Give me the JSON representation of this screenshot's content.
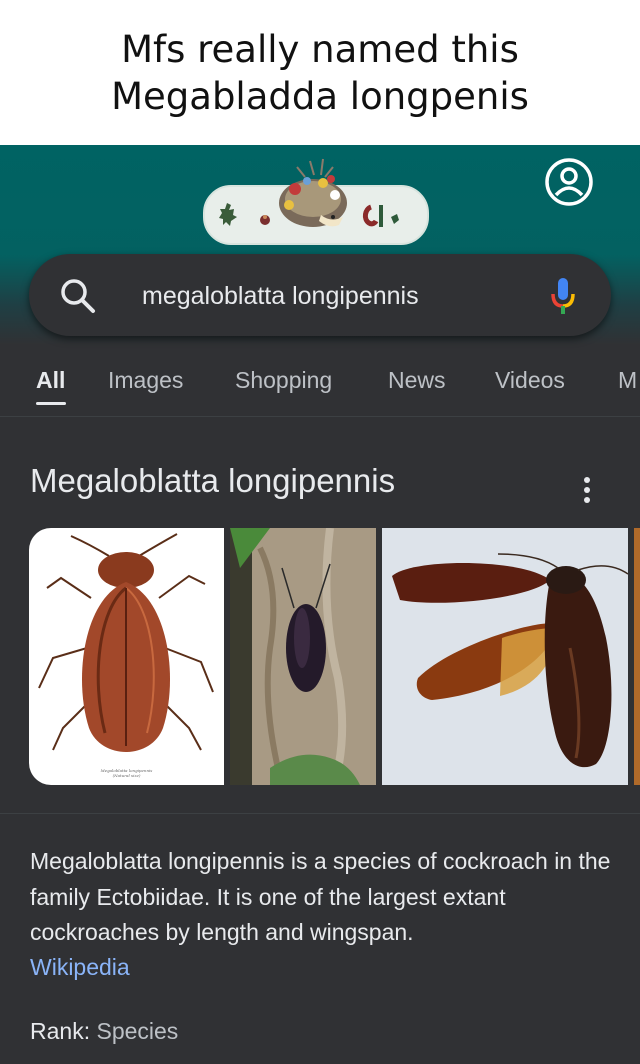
{
  "meme": {
    "caption_line1": "Mfs really named this",
    "caption_line2": "Megabladda longpenis"
  },
  "header": {
    "doodle_icon": "google-doodle-hedgehog",
    "account_icon": "account-circle-icon",
    "accent_color": "#006363"
  },
  "search": {
    "query": "megaloblatta longipennis",
    "search_icon": "search-icon",
    "mic_icon": "microphone-icon"
  },
  "tabs": [
    {
      "label": "All",
      "active": true
    },
    {
      "label": "Images",
      "active": false
    },
    {
      "label": "Shopping",
      "active": false
    },
    {
      "label": "News",
      "active": false
    },
    {
      "label": "Videos",
      "active": false
    },
    {
      "label": "M",
      "active": false
    }
  ],
  "knowledge_panel": {
    "title": "Megaloblatta longipennis",
    "images": [
      {
        "subject": "illustration-of-cockroach",
        "caption": "Megaloblatta longipennis",
        "subcaption": "(Natural size)"
      },
      {
        "subject": "cockroach-on-tree-bark"
      },
      {
        "subject": "cockroach-with-spread-wings"
      }
    ],
    "description": "Megaloblatta longipennis is a species of cockroach in the family Ectobiidae. It is one of the largest extant cockroaches by length and wingspan.",
    "source_link": "Wikipedia",
    "rank_label": "Rank:",
    "rank_value": "Species"
  }
}
